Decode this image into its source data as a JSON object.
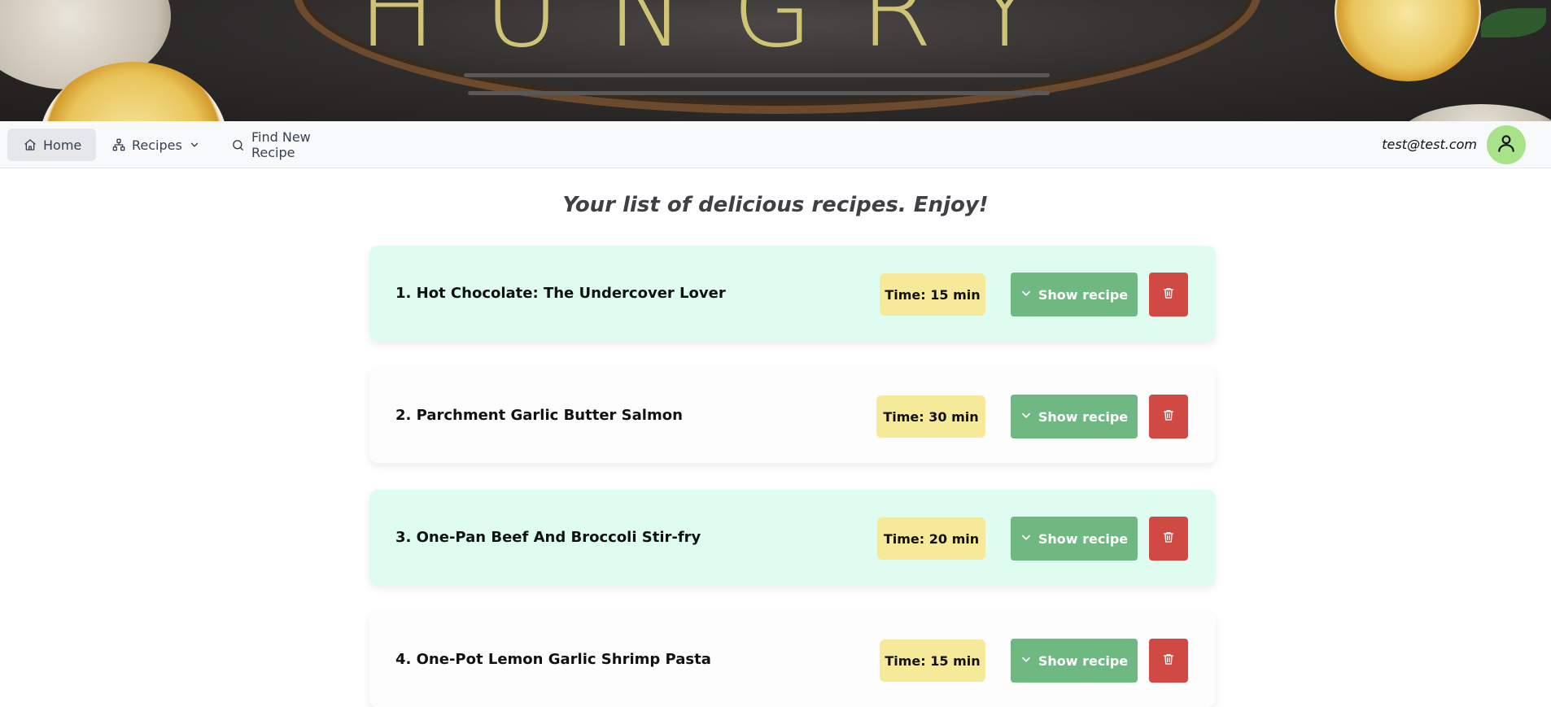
{
  "nav": {
    "home_label": "Home",
    "recipes_label": "Recipes",
    "find_label": "Find New Recipe",
    "user_email": "test@test.com"
  },
  "page": {
    "title": "Your list of delicious recipes. Enjoy!"
  },
  "recipes": [
    {
      "title": "1. Hot Chocolate: The Undercover Lover",
      "time": "Time: 15 min",
      "show_label": "Show recipe"
    },
    {
      "title": "2. Parchment Garlic Butter Salmon",
      "time": "Time: 30 min",
      "show_label": "Show recipe"
    },
    {
      "title": "3. One-Pan Beef And Broccoli Stir-fry",
      "time": "Time: 20 min",
      "show_label": "Show recipe"
    },
    {
      "title": "4. One-Pot Lemon Garlic Shrimp Pasta",
      "time": "Time: 15 min",
      "show_label": "Show recipe"
    }
  ],
  "colors": {
    "card_mint": "#defdf0",
    "time_badge": "#f7e99a",
    "show_button": "#6fb882",
    "delete_button": "#d04a43",
    "avatar": "#a8e38a"
  },
  "icons": {
    "home": "home-icon",
    "recipes": "sitemap-icon",
    "recipes_dropdown": "chevron-down-icon",
    "find": "search-icon",
    "avatar": "user-icon",
    "show": "chevron-down-icon",
    "delete": "trash-icon"
  }
}
